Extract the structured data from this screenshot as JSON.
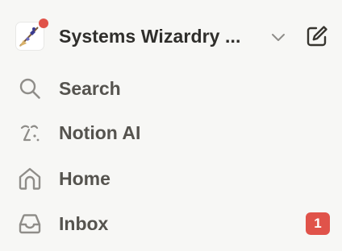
{
  "workspace": {
    "name": "Systems Wizardry ...",
    "avatar_icon": "wizard-broom-icon",
    "has_notification_dot": true
  },
  "actions": {
    "chevron_icon": "chevron-down-icon",
    "new_page_icon": "compose-icon"
  },
  "nav": {
    "items": [
      {
        "label": "Search",
        "icon": "search-icon"
      },
      {
        "label": "Notion AI",
        "icon": "notion-ai-face-icon"
      },
      {
        "label": "Home",
        "icon": "home-icon"
      },
      {
        "label": "Inbox",
        "icon": "inbox-icon",
        "badge": "1"
      }
    ]
  },
  "colors": {
    "background": "#f7f7f5",
    "text": "#37352f",
    "icon": "#8f8d89",
    "badge": "#e0534a"
  }
}
